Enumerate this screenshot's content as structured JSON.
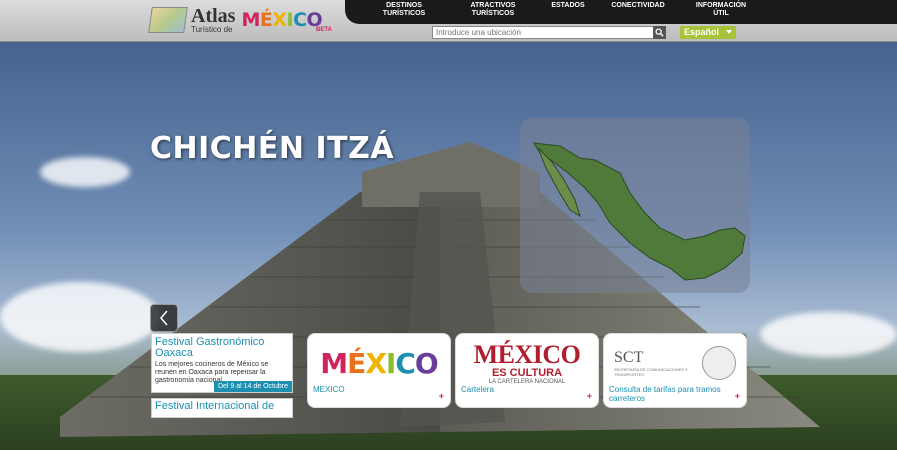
{
  "logo": {
    "atlas": "Atlas",
    "subtitle": "Turístico de",
    "mexico": "MÉXICO",
    "beta": "BETA"
  },
  "nav": {
    "items": [
      {
        "label": "DESTINOS TURÍSTICOS"
      },
      {
        "label": "ATRACTIVOS TURÍSTICOS"
      },
      {
        "label": "ESTADOS"
      },
      {
        "label": "CONECTIVIDAD"
      },
      {
        "label": "INFORMACIÓN ÚTIL"
      }
    ]
  },
  "search": {
    "placeholder": "Introduce una ubicación",
    "icon": "search-icon"
  },
  "language": {
    "selected": "Español"
  },
  "hero": {
    "title": "CHICHÉN ITZÁ"
  },
  "events": [
    {
      "title": "Festival Gastronómico Oaxaca",
      "description": "Los mejores cocineros de México se reunen en Oaxaca para repensar la gastronomía nacional.",
      "date": "Del 9 al 14 de Octubre"
    },
    {
      "title": "Festival Internacional de"
    }
  ],
  "promos": [
    {
      "label": "MEXICO",
      "brand": "MÉXICO"
    },
    {
      "label": "Cartelera",
      "brand": "MÉXICO",
      "brand_sub": "ES CULTURA",
      "brand_tagline": "LA CARTELERA NACIONAL"
    },
    {
      "label": "Consulta de tarifas para tramos carreteros",
      "brand": "SCT",
      "brand_sub": "SECRETARÍA DE COMUNICACIONES Y TRANSPORTES"
    }
  ],
  "colors": {
    "accent_blue": "#1d8fb0",
    "accent_green": "#a8c23a",
    "accent_pink": "#d0245c",
    "navbar": "#1a1a1a"
  }
}
